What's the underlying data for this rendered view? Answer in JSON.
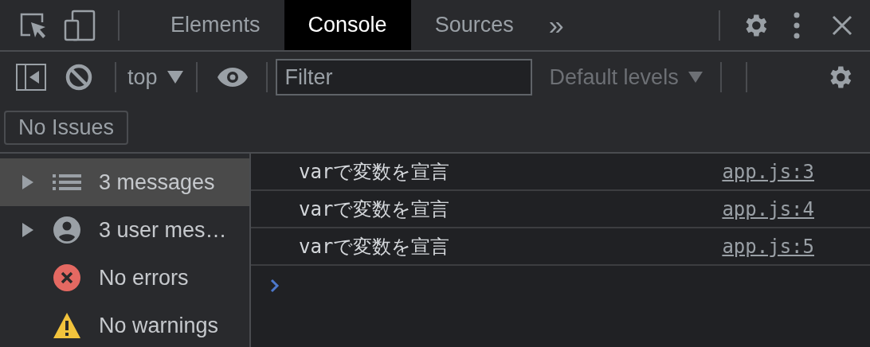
{
  "tabs": [
    {
      "label": "Elements",
      "selected": false
    },
    {
      "label": "Console",
      "selected": true
    },
    {
      "label": "Sources",
      "selected": false
    }
  ],
  "more_tabs": "»",
  "toolbar": {
    "context": "top",
    "filter": {
      "placeholder": "Filter"
    },
    "levels": "Default levels"
  },
  "issues_button": "No Issues",
  "sidebar": {
    "items": [
      {
        "kind": "messages",
        "label": "3 messages",
        "selected": true,
        "expanded": false
      },
      {
        "kind": "user",
        "label": "3 user mes…",
        "selected": false,
        "expanded": false
      },
      {
        "kind": "errors",
        "label": "No errors",
        "selected": false
      },
      {
        "kind": "warnings",
        "label": "No warnings",
        "selected": false
      }
    ]
  },
  "messages": [
    {
      "text": "varで変数を宣言",
      "source": "app.js:3"
    },
    {
      "text": "varで変数を宣言",
      "source": "app.js:4"
    },
    {
      "text": "varで変数を宣言",
      "source": "app.js:5"
    }
  ]
}
